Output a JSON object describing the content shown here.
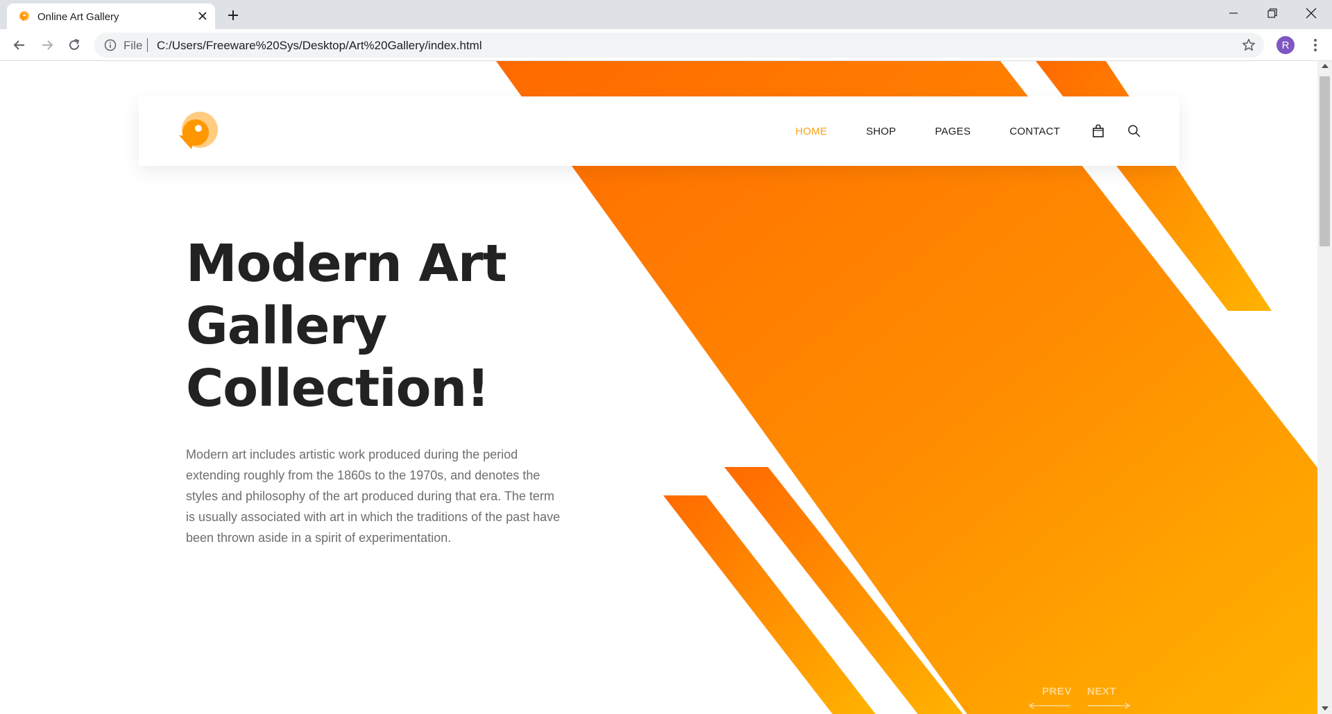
{
  "browser": {
    "tab_title": "Online Art Gallery",
    "scheme_label": "File",
    "url": "C:/Users/Freeware%20Sys/Desktop/Art%20Gallery/index.html",
    "profile_initial": "R"
  },
  "site": {
    "nav": {
      "home": "HOME",
      "shop": "SHOP",
      "pages": "PAGES",
      "contact": "CONTACT"
    },
    "hero": {
      "title_line1": "Modern Art",
      "title_line2": "Gallery",
      "title_line3": "Collection!",
      "description": "Modern art includes artistic work produced during the period extending roughly from the 1860s to the 1970s, and denotes the styles and philosophy of the art produced during that era. The term is usually associated with art in which the traditions of the past have been thrown aside in a spirit of experimentation."
    },
    "slider": {
      "prev_label": "PREV",
      "next_label": "NEXT"
    }
  },
  "colors": {
    "accent": "#f9a21b",
    "orange_dark": "#ff6a00",
    "orange_light": "#ffb300"
  }
}
